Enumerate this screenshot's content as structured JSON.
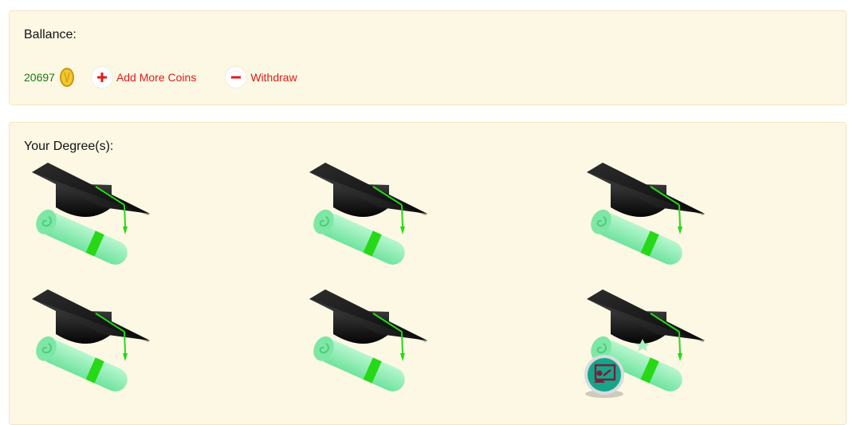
{
  "balance": {
    "title": "Ballance:",
    "amount": "20697",
    "coin_icon": "gold-coin-icon",
    "add_label": "Add More Coins",
    "withdraw_label": "Withdraw",
    "add_icon": "plus-icon",
    "withdraw_icon": "minus-icon",
    "accent_color": "#e01b1b",
    "amount_color": "#1a7a14"
  },
  "degrees": {
    "title": "Your Degree(s):",
    "count": 6,
    "icon": "graduation-cap-diploma-icon",
    "special_icon": "teacher-presentation-icon"
  }
}
